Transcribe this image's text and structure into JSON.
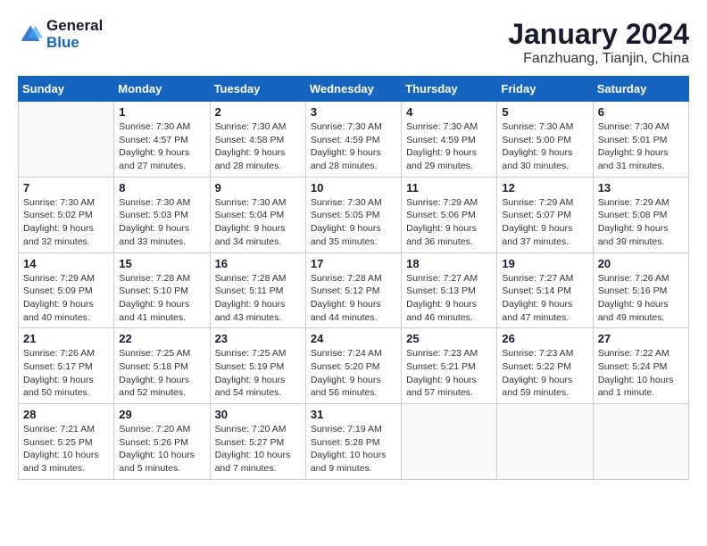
{
  "header": {
    "logo_line1": "General",
    "logo_line2": "Blue",
    "title": "January 2024",
    "subtitle": "Fanzhuang, Tianjin, China"
  },
  "weekdays": [
    "Sunday",
    "Monday",
    "Tuesday",
    "Wednesday",
    "Thursday",
    "Friday",
    "Saturday"
  ],
  "weeks": [
    [
      {
        "day": "",
        "sunrise": "",
        "sunset": "",
        "daylight": ""
      },
      {
        "day": "1",
        "sunrise": "Sunrise: 7:30 AM",
        "sunset": "Sunset: 4:57 PM",
        "daylight": "Daylight: 9 hours and 27 minutes."
      },
      {
        "day": "2",
        "sunrise": "Sunrise: 7:30 AM",
        "sunset": "Sunset: 4:58 PM",
        "daylight": "Daylight: 9 hours and 28 minutes."
      },
      {
        "day": "3",
        "sunrise": "Sunrise: 7:30 AM",
        "sunset": "Sunset: 4:59 PM",
        "daylight": "Daylight: 9 hours and 28 minutes."
      },
      {
        "day": "4",
        "sunrise": "Sunrise: 7:30 AM",
        "sunset": "Sunset: 4:59 PM",
        "daylight": "Daylight: 9 hours and 29 minutes."
      },
      {
        "day": "5",
        "sunrise": "Sunrise: 7:30 AM",
        "sunset": "Sunset: 5:00 PM",
        "daylight": "Daylight: 9 hours and 30 minutes."
      },
      {
        "day": "6",
        "sunrise": "Sunrise: 7:30 AM",
        "sunset": "Sunset: 5:01 PM",
        "daylight": "Daylight: 9 hours and 31 minutes."
      }
    ],
    [
      {
        "day": "7",
        "sunrise": "Sunrise: 7:30 AM",
        "sunset": "Sunset: 5:02 PM",
        "daylight": "Daylight: 9 hours and 32 minutes."
      },
      {
        "day": "8",
        "sunrise": "Sunrise: 7:30 AM",
        "sunset": "Sunset: 5:03 PM",
        "daylight": "Daylight: 9 hours and 33 minutes."
      },
      {
        "day": "9",
        "sunrise": "Sunrise: 7:30 AM",
        "sunset": "Sunset: 5:04 PM",
        "daylight": "Daylight: 9 hours and 34 minutes."
      },
      {
        "day": "10",
        "sunrise": "Sunrise: 7:30 AM",
        "sunset": "Sunset: 5:05 PM",
        "daylight": "Daylight: 9 hours and 35 minutes."
      },
      {
        "day": "11",
        "sunrise": "Sunrise: 7:29 AM",
        "sunset": "Sunset: 5:06 PM",
        "daylight": "Daylight: 9 hours and 36 minutes."
      },
      {
        "day": "12",
        "sunrise": "Sunrise: 7:29 AM",
        "sunset": "Sunset: 5:07 PM",
        "daylight": "Daylight: 9 hours and 37 minutes."
      },
      {
        "day": "13",
        "sunrise": "Sunrise: 7:29 AM",
        "sunset": "Sunset: 5:08 PM",
        "daylight": "Daylight: 9 hours and 39 minutes."
      }
    ],
    [
      {
        "day": "14",
        "sunrise": "Sunrise: 7:29 AM",
        "sunset": "Sunset: 5:09 PM",
        "daylight": "Daylight: 9 hours and 40 minutes."
      },
      {
        "day": "15",
        "sunrise": "Sunrise: 7:28 AM",
        "sunset": "Sunset: 5:10 PM",
        "daylight": "Daylight: 9 hours and 41 minutes."
      },
      {
        "day": "16",
        "sunrise": "Sunrise: 7:28 AM",
        "sunset": "Sunset: 5:11 PM",
        "daylight": "Daylight: 9 hours and 43 minutes."
      },
      {
        "day": "17",
        "sunrise": "Sunrise: 7:28 AM",
        "sunset": "Sunset: 5:12 PM",
        "daylight": "Daylight: 9 hours and 44 minutes."
      },
      {
        "day": "18",
        "sunrise": "Sunrise: 7:27 AM",
        "sunset": "Sunset: 5:13 PM",
        "daylight": "Daylight: 9 hours and 46 minutes."
      },
      {
        "day": "19",
        "sunrise": "Sunrise: 7:27 AM",
        "sunset": "Sunset: 5:14 PM",
        "daylight": "Daylight: 9 hours and 47 minutes."
      },
      {
        "day": "20",
        "sunrise": "Sunrise: 7:26 AM",
        "sunset": "Sunset: 5:16 PM",
        "daylight": "Daylight: 9 hours and 49 minutes."
      }
    ],
    [
      {
        "day": "21",
        "sunrise": "Sunrise: 7:26 AM",
        "sunset": "Sunset: 5:17 PM",
        "daylight": "Daylight: 9 hours and 50 minutes."
      },
      {
        "day": "22",
        "sunrise": "Sunrise: 7:25 AM",
        "sunset": "Sunset: 5:18 PM",
        "daylight": "Daylight: 9 hours and 52 minutes."
      },
      {
        "day": "23",
        "sunrise": "Sunrise: 7:25 AM",
        "sunset": "Sunset: 5:19 PM",
        "daylight": "Daylight: 9 hours and 54 minutes."
      },
      {
        "day": "24",
        "sunrise": "Sunrise: 7:24 AM",
        "sunset": "Sunset: 5:20 PM",
        "daylight": "Daylight: 9 hours and 56 minutes."
      },
      {
        "day": "25",
        "sunrise": "Sunrise: 7:23 AM",
        "sunset": "Sunset: 5:21 PM",
        "daylight": "Daylight: 9 hours and 57 minutes."
      },
      {
        "day": "26",
        "sunrise": "Sunrise: 7:23 AM",
        "sunset": "Sunset: 5:22 PM",
        "daylight": "Daylight: 9 hours and 59 minutes."
      },
      {
        "day": "27",
        "sunrise": "Sunrise: 7:22 AM",
        "sunset": "Sunset: 5:24 PM",
        "daylight": "Daylight: 10 hours and 1 minute."
      }
    ],
    [
      {
        "day": "28",
        "sunrise": "Sunrise: 7:21 AM",
        "sunset": "Sunset: 5:25 PM",
        "daylight": "Daylight: 10 hours and 3 minutes."
      },
      {
        "day": "29",
        "sunrise": "Sunrise: 7:20 AM",
        "sunset": "Sunset: 5:26 PM",
        "daylight": "Daylight: 10 hours and 5 minutes."
      },
      {
        "day": "30",
        "sunrise": "Sunrise: 7:20 AM",
        "sunset": "Sunset: 5:27 PM",
        "daylight": "Daylight: 10 hours and 7 minutes."
      },
      {
        "day": "31",
        "sunrise": "Sunrise: 7:19 AM",
        "sunset": "Sunset: 5:28 PM",
        "daylight": "Daylight: 10 hours and 9 minutes."
      },
      {
        "day": "",
        "sunrise": "",
        "sunset": "",
        "daylight": ""
      },
      {
        "day": "",
        "sunrise": "",
        "sunset": "",
        "daylight": ""
      },
      {
        "day": "",
        "sunrise": "",
        "sunset": "",
        "daylight": ""
      }
    ]
  ]
}
